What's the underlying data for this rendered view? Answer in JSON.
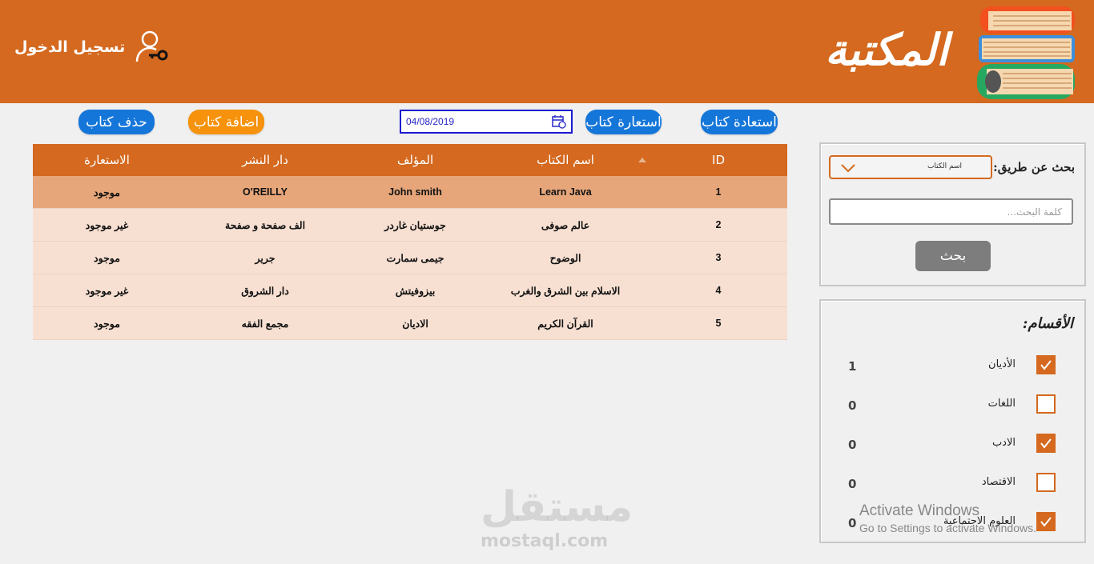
{
  "header": {
    "app_title": "المكتبة",
    "login_label": "تسجيل الدخول",
    "brand_color": "#d4691f"
  },
  "toolbar": {
    "return_book": "استعادة كتاب",
    "borrow_book": "استعارة كتاب",
    "date_value": "04/08/2019",
    "add_book": "اضافة كتاب",
    "delete_book": "حذف كتاب"
  },
  "table": {
    "columns": [
      "ID",
      "اسم الكتاب",
      "المؤلف",
      "دار النشر",
      "الاستعارة"
    ],
    "rows": [
      {
        "id": "1",
        "title": "Learn Java",
        "author": "John smith",
        "publisher": "O'REILLY",
        "status": "موجود"
      },
      {
        "id": "2",
        "title": "عالم صوفى",
        "author": "جوستيان غاردر",
        "publisher": "الف صفحة و صفحة",
        "status": "غير موجود"
      },
      {
        "id": "3",
        "title": "الوضوح",
        "author": "جيمى سمارت",
        "publisher": "جرير",
        "status": "موجود"
      },
      {
        "id": "4",
        "title": "الاسلام بين الشرق والغرب",
        "author": "بيزوفيتش",
        "publisher": "دار الشروق",
        "status": "غير موجود"
      },
      {
        "id": "5",
        "title": "القرآن الكريم",
        "author": "الاديان",
        "publisher": "مجمع الفقه",
        "status": "موجود"
      }
    ]
  },
  "search": {
    "label": "بحث عن طريق:",
    "selected_option": "اسم الكتاب",
    "placeholder": "كلمة البحث...",
    "button": "بحث"
  },
  "categories": {
    "title": "الأقسام:",
    "items": [
      {
        "label": "الأديان",
        "count": "1",
        "checked": true
      },
      {
        "label": "اللغات",
        "count": "0",
        "checked": false
      },
      {
        "label": "الادب",
        "count": "0",
        "checked": true
      },
      {
        "label": "الاقتصاد",
        "count": "0",
        "checked": false
      },
      {
        "label": "العلوم الاجتماعية",
        "count": "0",
        "checked": true
      }
    ]
  },
  "watermark": {
    "arabic": "مستقل",
    "latin": "mostaql.com"
  },
  "os_overlay": {
    "title": "Activate Windows",
    "subtitle": "Go to Settings to activate Windows."
  }
}
